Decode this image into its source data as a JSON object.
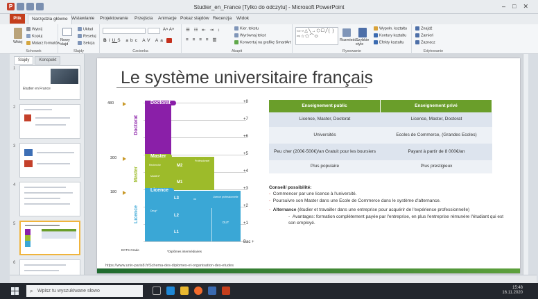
{
  "window": {
    "title": "Studier_en_France [Tylko do odczytu] - Microsoft PowerPoint",
    "min": "–",
    "max": "□",
    "close": "✕"
  },
  "tabs": [
    "Plik",
    "Narzędzia główne",
    "Wstawianie",
    "Projektowanie",
    "Przejścia",
    "Animacje",
    "Pokaz slajdów",
    "Recenzja",
    "Widok"
  ],
  "ribbon": {
    "clipboard": {
      "paste": "Wklej",
      "cut": "Wytnij",
      "copy": "Kopiuj",
      "format": "Malarz formatów",
      "label": "Schowek"
    },
    "slides": {
      "new": "Nowy slajd",
      "layout": "Układ",
      "reset": "Resetuj",
      "section": "Sekcja",
      "label": "Slajdy"
    },
    "font": {
      "label": "Czcionka"
    },
    "paragraph": {
      "direction": "Kier. tekstu",
      "align": "Wyrównaj tekst",
      "smartart": "Konwertuj na grafikę SmartArt",
      "label": "Akapit"
    },
    "drawing": {
      "arrange": "Rozmieść",
      "styles": "Szybkie style",
      "fill": "Wypełn. kształtu",
      "outline": "Kontury kształtu",
      "effects": "Efekty kształtu",
      "label": "Rysowanie"
    },
    "editing": {
      "find": "Znajdź",
      "replace": "Zamień",
      "select": "Zaznacz",
      "label": "Edytowanie"
    }
  },
  "leftpane": {
    "tab_slides": "Slajdy",
    "tab_outline": "Konspekt",
    "thumb1_title": "Etudier en France"
  },
  "slide": {
    "title": "Le système universitaire français",
    "diagram": {
      "left_ticks": [
        "480",
        "300",
        "180"
      ],
      "right_ticks": [
        "+8",
        "+7",
        "+6",
        "+5",
        "+4",
        "+3",
        "+2",
        "+1",
        "Bac +"
      ],
      "levels": {
        "doctorat": "Doctorat",
        "master": "Master",
        "licence": "Licence"
      },
      "master_inner": {
        "m2": "M2",
        "m1": "M1",
        "recherche": "Recherche",
        "professionnel": "Professionnel",
        "mastere": "Mastère*"
      },
      "licence_inner": {
        "l3": "L3",
        "l2": "L2",
        "l1": "L1",
        "ou": "ou",
        "lp": "Licence professionnelle",
        "deug": "Deug*",
        "dut": "DUT"
      },
      "footer_left": "ECTS  Grade",
      "footer_mid": "*Diplômes intermédiaires"
    },
    "table": {
      "headers": [
        "Enseignement public",
        "Enseignement privé"
      ],
      "rows": [
        [
          "Licence, Master, Doctorat",
          "Licence, Master, Doctorat"
        ],
        [
          "Universités",
          "Ecoles de Commerce, (Grandes Ecoles)"
        ],
        [
          "Peu cher (200€-500€)/an Gratuit pour les boursiers",
          "Payant à partir de 8 000€/an"
        ],
        [
          "Plus populaire",
          "Plus prestigieux"
        ]
      ]
    },
    "notes": {
      "heading": "Conseil/ possibilité:",
      "items": [
        "Commencer par une licence à l'université.",
        "Poursuivre son Master dans une Ecole de Commerce dans le système d'alternance."
      ],
      "alt_title": "Alternance",
      "alt_text": "(étudier et travailler dans une entreprise pour acquérir de l'expérience professionnelle)",
      "alt_sub": "Avantages: formation complètement payée par l'entreprise, en plus l'entreprise rémunère l'étudiant qui est son employé."
    },
    "source": "https://www.univ-paris8.fr/Schema-des-diplomes-et-organisation-des-etudes"
  },
  "taskbar": {
    "search": "Wpisz tu wyszukiwane słowo",
    "time": "15:48",
    "date": "16.11.2020"
  },
  "colors": {
    "doctorat": "#8a1fa8",
    "master": "#9dbb2a",
    "licence": "#3aa7d6",
    "header_green": "#6a9e2a",
    "accent_red": "#c43e1c"
  }
}
